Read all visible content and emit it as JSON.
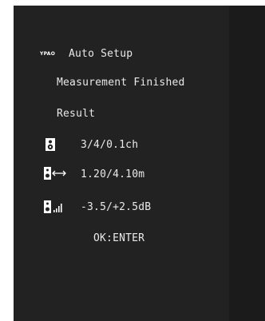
{
  "screen": {
    "logo_text": "YPAO",
    "title": "Auto Setup",
    "status": "Measurement Finished",
    "result_heading": "Result",
    "results": [
      {
        "icon": "speaker-icon",
        "value": "3/4/0.1ch"
      },
      {
        "icon": "speaker-distance-icon",
        "value": "1.20/4.10m"
      },
      {
        "icon": "speaker-level-icon",
        "value": "-3.5/+2.5dB"
      }
    ],
    "prompt": "OK:ENTER"
  },
  "colors": {
    "background": "#222222",
    "text": "#e9e9e9",
    "page": "#ffffff"
  }
}
